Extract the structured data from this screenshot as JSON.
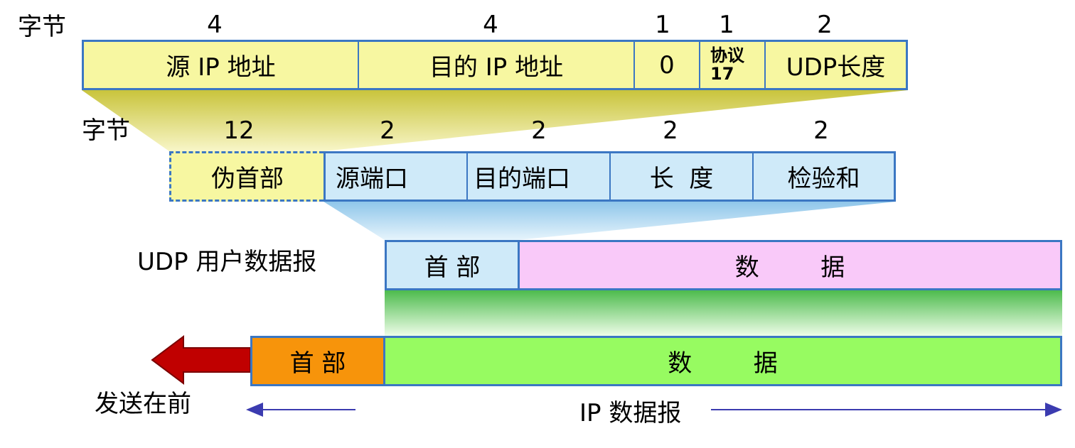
{
  "pseudo_header": {
    "byte_label": "字节",
    "byte_counts": [
      "4",
      "4",
      "1",
      "1",
      "2"
    ],
    "fields": [
      "源 IP 地址",
      "目的 IP 地址",
      "0",
      "协议",
      "UDP长度"
    ],
    "protocol_value": "17"
  },
  "udp_header": {
    "byte_label": "字节",
    "byte_counts": [
      "12",
      "2",
      "2",
      "2",
      "2"
    ],
    "pseudo_label": "伪首部",
    "fields": [
      "源端口",
      "目的端口",
      "长  度",
      "检验和"
    ]
  },
  "udp_datagram": {
    "label": "UDP 用户数据报",
    "header": "首 部",
    "data": "数        据"
  },
  "ip_datagram": {
    "header": "首 部",
    "data": "数        据",
    "label": "IP 数据报"
  },
  "send_first": "发送在前",
  "colors": {
    "pseudo_fill": "#f7f7a1",
    "udp_header_fill": "#cfeaf9",
    "udp_data_fill": "#f9c9f9",
    "ip_header_fill": "#f7940b",
    "ip_data_fill": "#97fb61",
    "border": "#3b77c3",
    "arrow": "#c00000"
  }
}
